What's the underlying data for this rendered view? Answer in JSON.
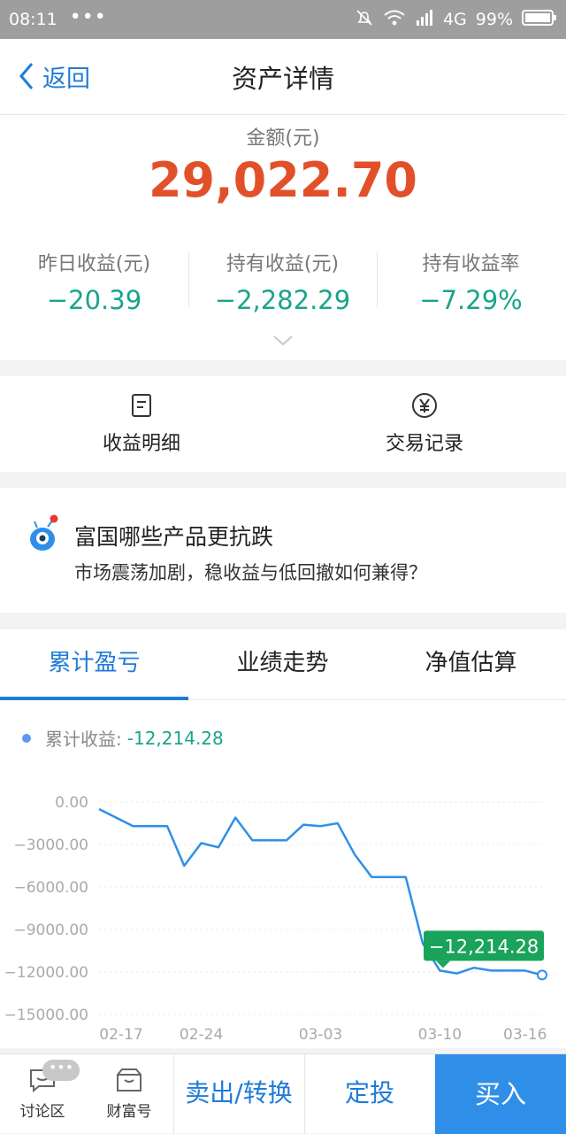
{
  "statusbar": {
    "time": "08:11",
    "dots": "•••",
    "network": "4G",
    "battery": "99%"
  },
  "nav": {
    "back_label": "返回",
    "title": "资产详情"
  },
  "summary": {
    "amount_label": "金额(元)",
    "amount": "29,022.70",
    "stats": [
      {
        "label": "昨日收益(元)",
        "value": "−20.39"
      },
      {
        "label": "持有收益(元)",
        "value": "−2,282.29"
      },
      {
        "label": "持有收益率",
        "value": "−7.29%"
      }
    ]
  },
  "actions": [
    {
      "label": "收益明细",
      "icon": "document-icon"
    },
    {
      "label": "交易记录",
      "icon": "yen-icon"
    }
  ],
  "promo": {
    "title": "富国哪些产品更抗跌",
    "subtitle": "市场震荡加剧，稳收益与低回撤如何兼得？"
  },
  "tabs": [
    "累计盈亏",
    "业绩走势",
    "净值估算"
  ],
  "active_tab": 0,
  "legend": {
    "label": "累计收益:",
    "value": "-12,214.28"
  },
  "colors": {
    "accent": "#1f7bd8",
    "negative": "#19a58b",
    "amount": "#e2502a",
    "line": "#2f8fe8",
    "tooltip": "#1aa35a"
  },
  "chart_data": {
    "type": "line",
    "series": [
      {
        "name": "累计收益",
        "values": [
          -500,
          -1100,
          -1700,
          -1700,
          -1700,
          -4500,
          -2900,
          -3200,
          -1100,
          -2700,
          -2700,
          -2700,
          -1600,
          -1700,
          -1500,
          -3700,
          -5300,
          -5300,
          -5300,
          -10000,
          -11900,
          -12100,
          -11700,
          -11900,
          -11900,
          -11900,
          -12214.28
        ]
      }
    ],
    "x_tick_labels": [
      "02-17",
      "02-24",
      "03-03",
      "03-10",
      "03-16"
    ],
    "y_tick_labels": [
      "0.00",
      "−3000.00",
      "−6000.00",
      "−9000.00",
      "−12000.00",
      "−15000.00"
    ],
    "y_ticks": [
      0,
      -3000,
      -6000,
      -9000,
      -12000,
      -15000
    ],
    "ylim": [
      -15000,
      0
    ],
    "grid": true,
    "last_value_label": "−12,214.28"
  },
  "bottombar": {
    "discuss": "讨论区",
    "badge": "•••",
    "wealth": "财富号",
    "sell": "卖出/转换",
    "fixed": "定投",
    "buy": "买入"
  }
}
